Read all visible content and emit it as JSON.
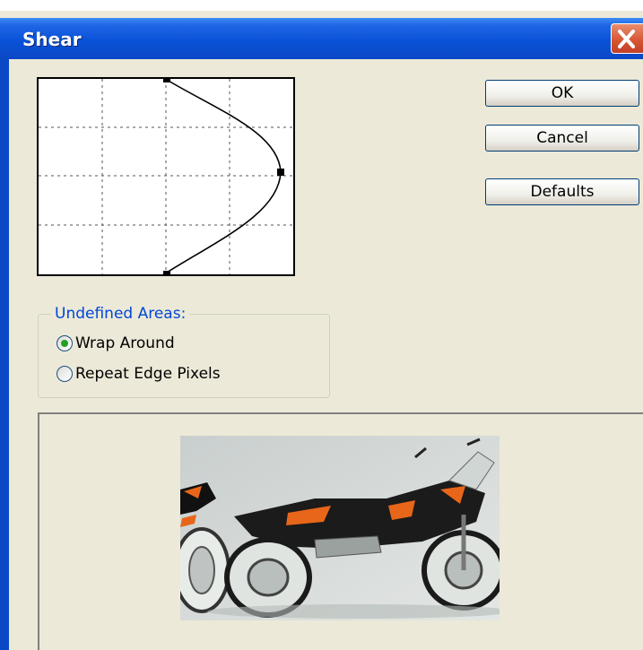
{
  "window": {
    "title": "Shear"
  },
  "buttons": {
    "ok": "OK",
    "cancel": "Cancel",
    "defaults": "Defaults"
  },
  "undefined_areas": {
    "legend": "Undefined Areas:",
    "options": [
      {
        "label": "Wrap Around",
        "selected": true
      },
      {
        "label": "Repeat Edge Pixels",
        "selected": false
      }
    ]
  },
  "colors": {
    "titlebar": "#0a52d8",
    "dialog_bg": "#ece9d8",
    "legend_text": "#0046d5",
    "radio_selected": "#21a121"
  },
  "icons": {
    "close": "close-icon"
  }
}
